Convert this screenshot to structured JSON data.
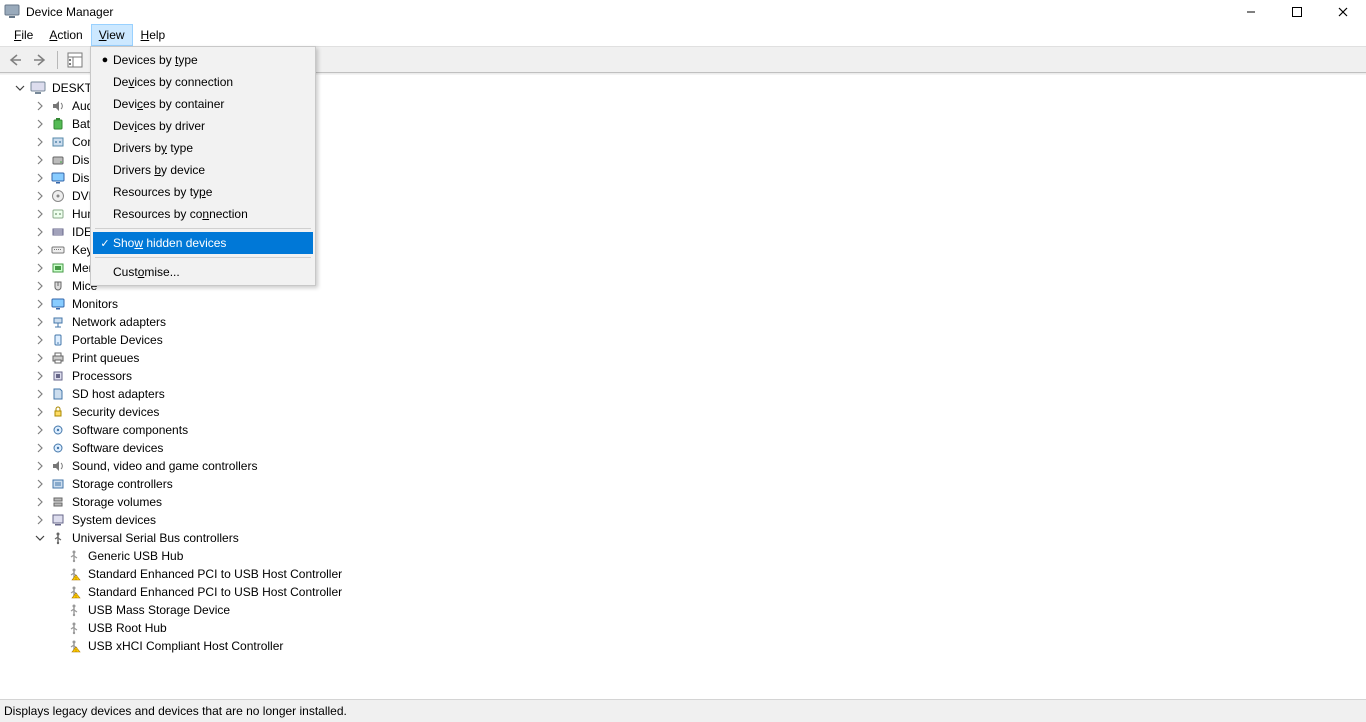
{
  "window": {
    "title": "Device Manager"
  },
  "menubar": {
    "file": "File",
    "action": "Action",
    "view": "View",
    "help": "Help"
  },
  "view_menu": {
    "by_type": "Devices by type",
    "by_connection": "Devices by connection",
    "by_container": "Devices by container",
    "by_driver": "Devices by driver",
    "drivers_by_type": "Drivers by type",
    "drivers_by_device": "Drivers by device",
    "resources_by_type": "Resources by type",
    "resources_by_connection": "Resources by connection",
    "show_hidden": "Show hidden devices",
    "customise": "Customise..."
  },
  "tree": {
    "root": "DESKTO",
    "items": [
      {
        "label": "Aud"
      },
      {
        "label": "Batt"
      },
      {
        "label": "Com"
      },
      {
        "label": "Disk"
      },
      {
        "label": "Disp"
      },
      {
        "label": "DVD"
      },
      {
        "label": "Hum"
      },
      {
        "label": "IDE A"
      },
      {
        "label": "Keyb"
      },
      {
        "label": "Men"
      },
      {
        "label": "Mice"
      },
      {
        "label": "Monitors"
      },
      {
        "label": "Network adapters"
      },
      {
        "label": "Portable Devices"
      },
      {
        "label": "Print queues"
      },
      {
        "label": "Processors"
      },
      {
        "label": "SD host adapters"
      },
      {
        "label": "Security devices"
      },
      {
        "label": "Software components"
      },
      {
        "label": "Software devices"
      },
      {
        "label": "Sound, video and game controllers"
      },
      {
        "label": "Storage controllers"
      },
      {
        "label": "Storage volumes"
      },
      {
        "label": "System devices"
      }
    ],
    "usb": {
      "label": "Universal Serial Bus controllers",
      "children": [
        "Generic USB Hub",
        "Standard Enhanced PCI to USB Host Controller",
        "Standard Enhanced PCI to USB Host Controller",
        "USB Mass Storage Device",
        "USB Root Hub",
        "USB xHCI Compliant Host Controller"
      ]
    }
  },
  "statusbar": {
    "text": "Displays legacy devices and devices that are no longer installed."
  },
  "icons": {
    "computer": "🖥",
    "speaker": "🔊",
    "battery": "🔋",
    "port": "▣",
    "disk": "💽",
    "display": "🖵",
    "dvd": "💿",
    "hid": "👤",
    "ide": "▤",
    "keyboard": "⌨",
    "memory": "▦",
    "mouse": "🖱",
    "monitor": "🖵",
    "network": "🖧",
    "portable": "📱",
    "printer": "🖶",
    "cpu": "▢",
    "sd": "💾",
    "security": "🔒",
    "software": "⚙",
    "softdev": "⚙",
    "sound": "🔊",
    "storagectl": "⇄",
    "storagevol": "🗄",
    "system": "🖳",
    "usb": "ψ",
    "usbwarn": "⚠"
  }
}
